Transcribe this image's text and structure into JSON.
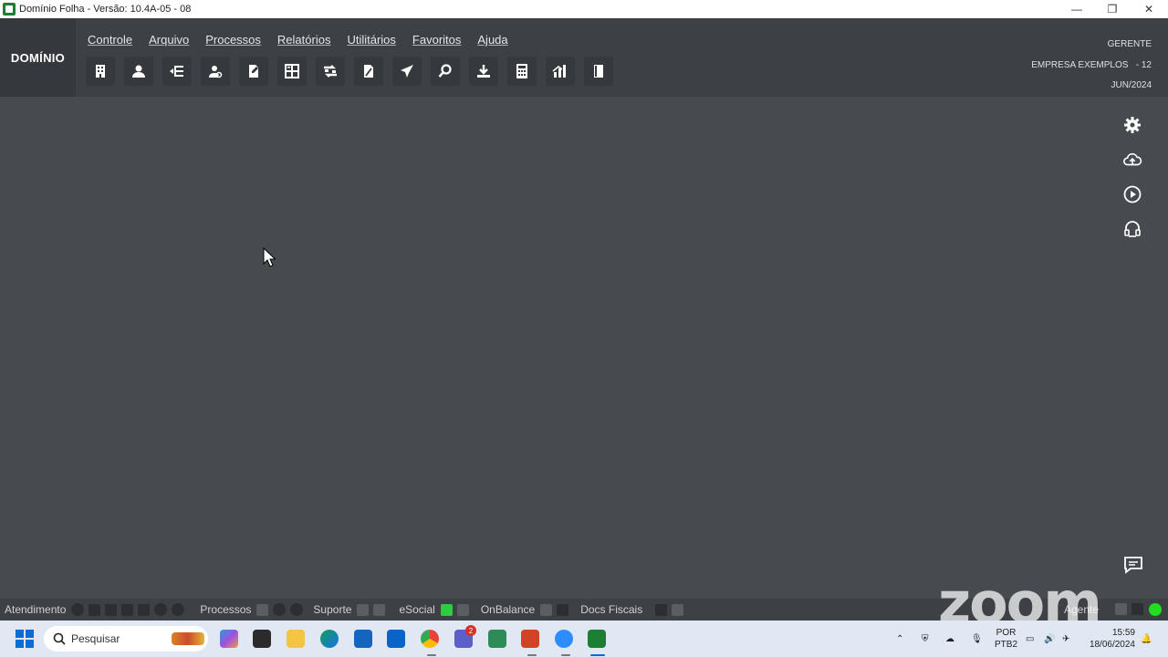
{
  "window": {
    "title": "Domínio Folha - Versão: 10.4A-05 - 08",
    "minimize": "—",
    "maximize": "❐",
    "close": "✕"
  },
  "header": {
    "logo": "DOMÍNIO",
    "menu": [
      "Controle",
      "Arquivo",
      "Processos",
      "Relatórios",
      "Utilitários",
      "Favoritos",
      "Ajuda"
    ],
    "toolbar_icons": [
      "building-icon",
      "person-icon",
      "list-arrow-icon",
      "person-search-icon",
      "document-edit-icon",
      "calculator-table-icon",
      "transfer-icon",
      "document-cut-icon",
      "airplane-icon",
      "magnifier-icon",
      "download-icon",
      "calculator-icon",
      "chart-icon",
      "book-icon"
    ],
    "user": "GERENTE",
    "company": "EMPRESA EXEMPLOS",
    "company_code": "- 12",
    "period": "JUN/2024"
  },
  "side_icons": [
    "gear-icon",
    "cloud-upload-icon",
    "play-icon",
    "support-headset-icon"
  ],
  "statusbar": {
    "atendimento": "Atendimento",
    "processos": "Processos",
    "suporte": "Suporte",
    "esocial": "eSocial",
    "onbalance": "OnBalance",
    "docs_fiscais": "Docs Fiscais",
    "agente": "Agente"
  },
  "watermark": "zoom",
  "taskbar": {
    "search_placeholder": "Pesquisar",
    "notification_badge": "2",
    "lang_line1": "POR",
    "lang_line2": "PTB2",
    "time": "15:59",
    "date": "18/06/2024"
  },
  "colors": {
    "workspace": "#474a4f",
    "header": "#3d4045",
    "status_ok": "#22dd22"
  }
}
